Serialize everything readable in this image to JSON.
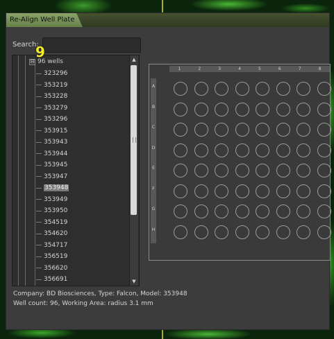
{
  "window": {
    "title": "Re-Align Well Plate"
  },
  "search": {
    "label": "Search:",
    "value": ""
  },
  "badge": {
    "count": "9"
  },
  "tree": {
    "root": {
      "expander": "⊟",
      "label": "96 wells"
    },
    "items": [
      {
        "label": "323296"
      },
      {
        "label": "353219"
      },
      {
        "label": "353228"
      },
      {
        "label": "353279"
      },
      {
        "label": "353296"
      },
      {
        "label": "353915"
      },
      {
        "label": "353943"
      },
      {
        "label": "353944"
      },
      {
        "label": "353945"
      },
      {
        "label": "353947"
      },
      {
        "label": "353948",
        "selected": true
      },
      {
        "label": "353949"
      },
      {
        "label": "353950"
      },
      {
        "label": "354519"
      },
      {
        "label": "354620"
      },
      {
        "label": "354717"
      },
      {
        "label": "356519"
      },
      {
        "label": "356620"
      },
      {
        "label": "356691"
      }
    ]
  },
  "info": {
    "line1": "Company: BD Biosciences, Type: Falcon, Model: 353948",
    "line2": "Well count: 96, Working Area: radius 3.1 mm"
  },
  "plate": {
    "columns": [
      "1",
      "2",
      "3",
      "4",
      "5",
      "6",
      "7",
      "8"
    ],
    "rows": [
      "A",
      "B",
      "C",
      "D",
      "E",
      "F",
      "G",
      "H"
    ]
  },
  "colors": {
    "window_bg": "#3c3c3c",
    "highlight": "#f3ec2a",
    "selected_item": "#7b7b7b"
  }
}
